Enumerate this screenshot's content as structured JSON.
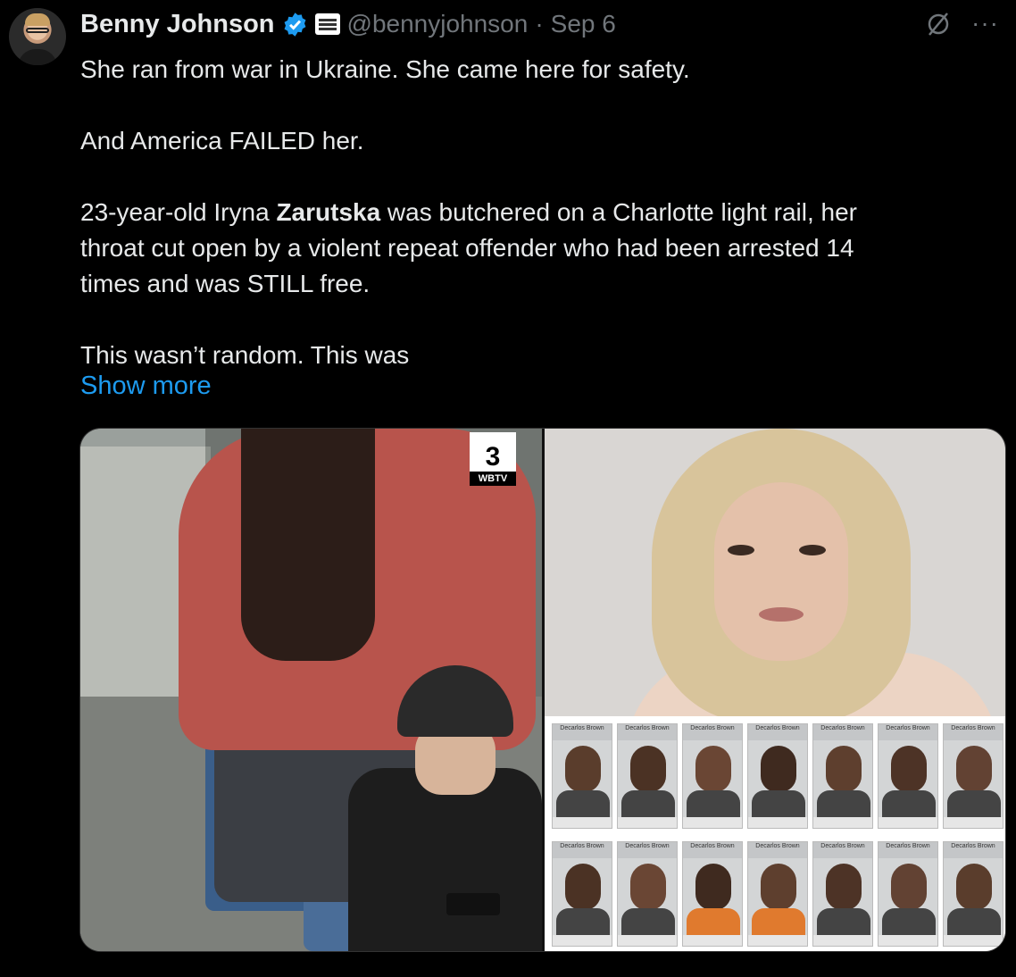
{
  "author": {
    "name": "Benny Johnson",
    "handle": "@bennyjohnson",
    "separator": "·",
    "date": "Sep 6"
  },
  "tweet": {
    "line1": "She ran from war in Ukraine. She came here for safety.",
    "line2": "And America FAILED her.",
    "line3_pre": "23-year-old Iryna ",
    "line3_bold": "Zarutska",
    "line3_post": " was butchered on a Charlotte light rail, her",
    "line4": "throat cut open by a violent repeat offender who had been arrested 14",
    "line5": "times and was STILL free.",
    "line6": "This wasn’t random. This was",
    "show_more": "Show more"
  },
  "actions": {
    "more_label": "···"
  },
  "media": {
    "left_logo_number": "3",
    "left_logo_label": "WBTV",
    "mugshot_label": "Decarlos Brown"
  },
  "colors": {
    "accent": "#1d9bf0",
    "background": "#000000",
    "secondary_text": "#71767b"
  }
}
